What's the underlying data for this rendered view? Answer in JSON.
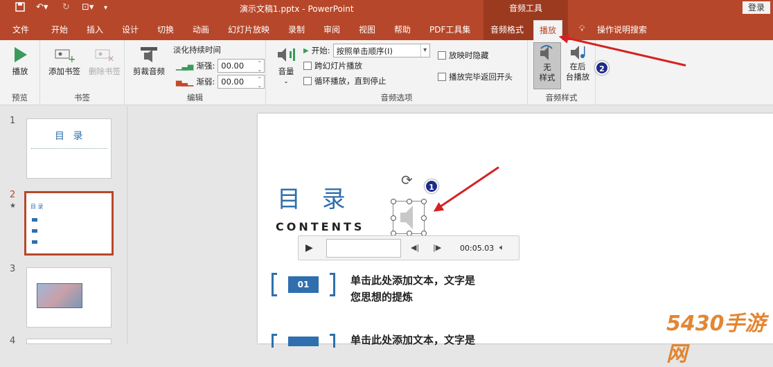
{
  "titlebar": {
    "title": "演示文稿1.pptx  -  PowerPoint",
    "context_header": "音频工具",
    "login": "登录"
  },
  "tabs": [
    {
      "label": "文件"
    },
    {
      "label": "开始"
    },
    {
      "label": "插入"
    },
    {
      "label": "设计"
    },
    {
      "label": "切换"
    },
    {
      "label": "动画"
    },
    {
      "label": "幻灯片放映"
    },
    {
      "label": "录制"
    },
    {
      "label": "审阅"
    },
    {
      "label": "视图"
    },
    {
      "label": "帮助"
    },
    {
      "label": "PDF工具集"
    },
    {
      "label": "音频格式"
    },
    {
      "label": "播放"
    }
  ],
  "tell_me": "操作说明搜索",
  "ribbon": {
    "preview": {
      "group": "预览",
      "play": "播放"
    },
    "bookmarks": {
      "group": "书签",
      "add": "添加书签",
      "remove": "删除书签"
    },
    "editing": {
      "group": "编辑",
      "trim": "剪裁音频",
      "fade_title": "淡化持续时间",
      "fade_in_label": "渐强:",
      "fade_in": "00.00",
      "fade_out_label": "渐弱:",
      "fade_out": "00.00"
    },
    "audio_options": {
      "group": "音频选项",
      "volume": "音量",
      "start_label": "开始:",
      "start_value": "按照单击顺序(I)",
      "cross_slides": "跨幻灯片播放",
      "loop": "循环播放，直到停止",
      "hide": "放映时隐藏",
      "rewind": "播放完毕返回开头"
    },
    "audio_styles": {
      "group": "音频样式",
      "no_style_1": "无",
      "no_style_2": "样式",
      "bg_play_1": "在后",
      "bg_play_2": "台播放"
    }
  },
  "slides": [
    {
      "num": "1",
      "title": "目 录"
    },
    {
      "num": "2",
      "star": "★",
      "title": "目 录"
    },
    {
      "num": "3"
    },
    {
      "num": "4"
    }
  ],
  "slide": {
    "title": "目 录",
    "subtitle": "CONTENTS",
    "item1_num": "01",
    "item1_line1": "单击此处添加文本，文字是",
    "item1_line2": "您思想的提炼",
    "item2_line1": "单击此处添加文本，文字是",
    "player_time": "00:05.03"
  },
  "badges": {
    "one": "1",
    "two": "2"
  },
  "watermark": "5430手游网",
  "colors": {
    "brand": "#b7472a",
    "accent_blue": "#2f6fad",
    "arrow": "#d42222"
  }
}
